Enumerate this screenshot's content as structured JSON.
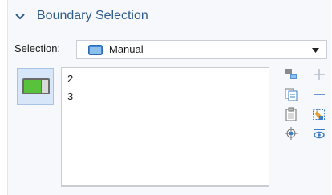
{
  "section": {
    "title": "Boundary Selection",
    "expanded": true
  },
  "selection": {
    "label": "Selection:",
    "value": "Manual"
  },
  "list": {
    "items": [
      "2",
      "3"
    ]
  },
  "tools": {
    "left_column": [
      "paste-selection-icon",
      "copy-selection-icon",
      "clipboard-icon",
      "zoom-to-selection-icon"
    ],
    "right_column": [
      "add-to-selection-icon",
      "remove-from-selection-icon",
      "clear-selection-icon",
      "create-selection-icon"
    ]
  },
  "colors": {
    "accent": "#2f5b8a",
    "panel_bg": "#f7f8fb",
    "entity_button_bg": "#d7e6f8"
  }
}
